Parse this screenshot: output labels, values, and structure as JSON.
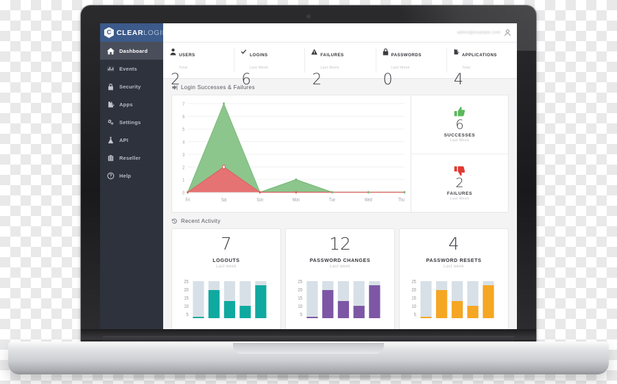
{
  "brand": {
    "badge_letter": "C",
    "name_primary": "CLEAR",
    "name_secondary": "LOGIN"
  },
  "topbar": {
    "user_email": "admin@example.com"
  },
  "sidebar": {
    "items": [
      {
        "label": "Dashboard",
        "icon": "home-icon",
        "active": true
      },
      {
        "label": "Events",
        "icon": "bar-chart-icon",
        "active": false
      },
      {
        "label": "Security",
        "icon": "lock-icon",
        "active": false
      },
      {
        "label": "Apps",
        "icon": "puzzle-icon",
        "active": false
      },
      {
        "label": "Settings",
        "icon": "gears-icon",
        "active": false
      },
      {
        "label": "API",
        "icon": "flask-icon",
        "active": false
      },
      {
        "label": "Reseller",
        "icon": "briefcase-icon",
        "active": false
      },
      {
        "label": "Help",
        "icon": "question-circle-icon",
        "active": false
      }
    ]
  },
  "stats": [
    {
      "label": "USERS",
      "sub": "Total",
      "value": "2",
      "icon": "user-icon"
    },
    {
      "label": "LOGINS",
      "sub": "Last Week",
      "value": "6",
      "icon": "check-icon"
    },
    {
      "label": "FAILURES",
      "sub": "Last Week",
      "value": "2",
      "icon": "warning-icon"
    },
    {
      "label": "PASSWORDS",
      "sub": "Last Week",
      "value": "0",
      "icon": "lock-icon"
    },
    {
      "label": "APPLICATIONS",
      "sub": "Total",
      "value": "4",
      "icon": "puzzle-icon"
    }
  ],
  "sections": {
    "login_chart": {
      "title": "Login Successes & Failures",
      "icon": "sign-in-icon"
    },
    "recent_activity": {
      "title": "Recent Activity",
      "icon": "history-icon"
    }
  },
  "summary": {
    "successes": {
      "value": "6",
      "label": "SUCCESSES",
      "sub": "Last Week",
      "icon": "thumbs-up-icon",
      "color": "#5cb85c"
    },
    "failures": {
      "value": "2",
      "label": "FAILURES",
      "sub": "Last Week",
      "icon": "thumbs-down-icon",
      "color": "#e03a34"
    }
  },
  "activity": [
    {
      "value": "7",
      "label": "LOGOUTS",
      "sub": "Last week",
      "color": "#0fa9a0",
      "track": "#d7e0e6",
      "yticks": [
        25,
        20,
        15,
        10,
        5
      ],
      "bars": [
        1,
        20,
        12,
        9,
        23
      ],
      "bar_max": 26
    },
    {
      "value": "12",
      "label": "PASSWORD CHANGES",
      "sub": "Last week",
      "color": "#7d56a5",
      "track": "#d7e0e6",
      "yticks": [
        25,
        20,
        15,
        10,
        5
      ],
      "bars": [
        1,
        20,
        12,
        9,
        23
      ],
      "bar_max": 26
    },
    {
      "value": "4",
      "label": "PASSWORD RESETS",
      "sub": "Last week",
      "color": "#f5a623",
      "track": "#d7e0e6",
      "yticks": [
        25,
        20,
        15,
        10,
        5
      ],
      "bars": [
        1,
        20,
        12,
        9,
        23
      ],
      "bar_max": 26
    }
  ],
  "chart_data": {
    "type": "area",
    "title": "Login Successes & Failures",
    "categories": [
      "Fri",
      "Sat",
      "Sun",
      "Mon",
      "Tue",
      "Wed",
      "Thu"
    ],
    "series": [
      {
        "name": "Successes",
        "values": [
          0,
          7,
          0,
          1,
          0,
          0,
          0
        ],
        "color": "#8cc68c",
        "line_color": "#7ab87a"
      },
      {
        "name": "Failures",
        "values": [
          0,
          2,
          0,
          0,
          0,
          0,
          0
        ],
        "color": "#e57373",
        "line_color": "#dc6060"
      }
    ],
    "xlabel": "",
    "ylabel": "",
    "ylim": [
      0,
      7
    ],
    "yticks": [
      0,
      1,
      2,
      3,
      4,
      5,
      6,
      7
    ],
    "grid": true,
    "legend": "none"
  }
}
